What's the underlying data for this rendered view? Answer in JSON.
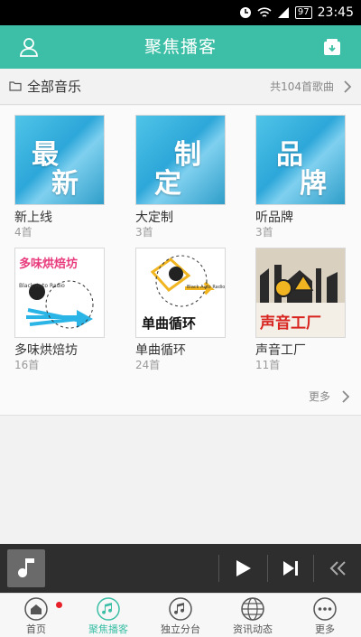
{
  "status_bar": {
    "time": "23:45",
    "battery": "97"
  },
  "header": {
    "title": "聚焦播客",
    "user_icon": "user-icon",
    "box_icon": "download-box-icon"
  },
  "section": {
    "title": "全部音乐",
    "count": "共104首歌曲"
  },
  "tiles": [
    {
      "name": "新上线",
      "count": "4首",
      "cover_text": [
        "最",
        "新"
      ]
    },
    {
      "name": "大定制",
      "count": "3首",
      "cover_text": [
        "制",
        "定"
      ]
    },
    {
      "name": "听品牌",
      "count": "3首",
      "cover_text": [
        "品",
        "牌"
      ]
    },
    {
      "name": "多味烘焙坊",
      "count": "16首",
      "cover_text": [
        "多味烘焙坊",
        "Black Auto Radio"
      ]
    },
    {
      "name": "单曲循环",
      "count": "24首",
      "cover_text": [
        "单曲循环",
        "Black Auto Radio"
      ]
    },
    {
      "name": "声音工厂",
      "count": "11首",
      "cover_text": [
        "声音工厂"
      ]
    }
  ],
  "more": {
    "label": "更多"
  },
  "player": {
    "art_icon": "music-note-icon",
    "play_icon": "play-icon",
    "next_icon": "next-icon",
    "collapse_icon": "double-chevron-left-icon"
  },
  "tabs": [
    {
      "label": "首页",
      "icon": "home-icon",
      "active": false,
      "badge": true
    },
    {
      "label": "聚焦播客",
      "icon": "music-note-icon",
      "active": true,
      "badge": false
    },
    {
      "label": "独立分台",
      "icon": "music-note-icon",
      "active": false,
      "badge": false
    },
    {
      "label": "资讯动态",
      "icon": "globe-icon",
      "active": false,
      "badge": false
    },
    {
      "label": "更多",
      "icon": "more-dots-icon",
      "active": false,
      "badge": false
    }
  ],
  "colors": {
    "accent": "#3cbfa6",
    "badge": "#e8202a",
    "player_bg": "#2e2e2e"
  }
}
